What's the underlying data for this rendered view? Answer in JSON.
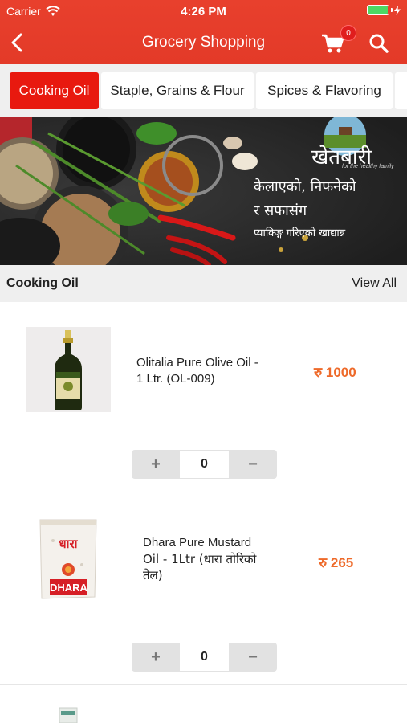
{
  "status_bar": {
    "carrier": "Carrier",
    "time": "4:26 PM"
  },
  "navbar": {
    "title": "Grocery Shopping",
    "cart_count": "0"
  },
  "category_tabs": [
    {
      "label": "Cooking Oil",
      "active": true
    },
    {
      "label": "Staple, Grains & Flour",
      "active": false
    },
    {
      "label": "Spices & Flavoring",
      "active": false
    }
  ],
  "banner": {
    "brand": "खेतबारी",
    "brand_tagline": "for the healthy family",
    "line1": "केलाएको, निफनेको",
    "line2": "र सफासंग",
    "line3": "प्याकिङ्ग गरिएको खाद्यान्न"
  },
  "section": {
    "title": "Cooking Oil",
    "view_all": "View All"
  },
  "products": [
    {
      "name_line1": "Olitalia Pure Olive Oil -",
      "name_line2": "1 Ltr. (OL-009)",
      "name_line3": "",
      "price": "रु 1000",
      "quantity": "0",
      "image_label": "OLITALIA"
    },
    {
      "name_line1": "Dhara Pure Mustard",
      "name_line2": "Oil - 1Ltr (धारा तोरिको",
      "name_line3": "तेल)",
      "price": "रु 265",
      "quantity": "0",
      "image_label": "DHARA",
      "image_label_np": "धारा"
    }
  ],
  "stepper": {
    "plus": "+",
    "minus": "−"
  },
  "colors": {
    "header_red": "#e33a28",
    "active_tab": "#e8190f",
    "price_orange": "#ee6a2a"
  }
}
